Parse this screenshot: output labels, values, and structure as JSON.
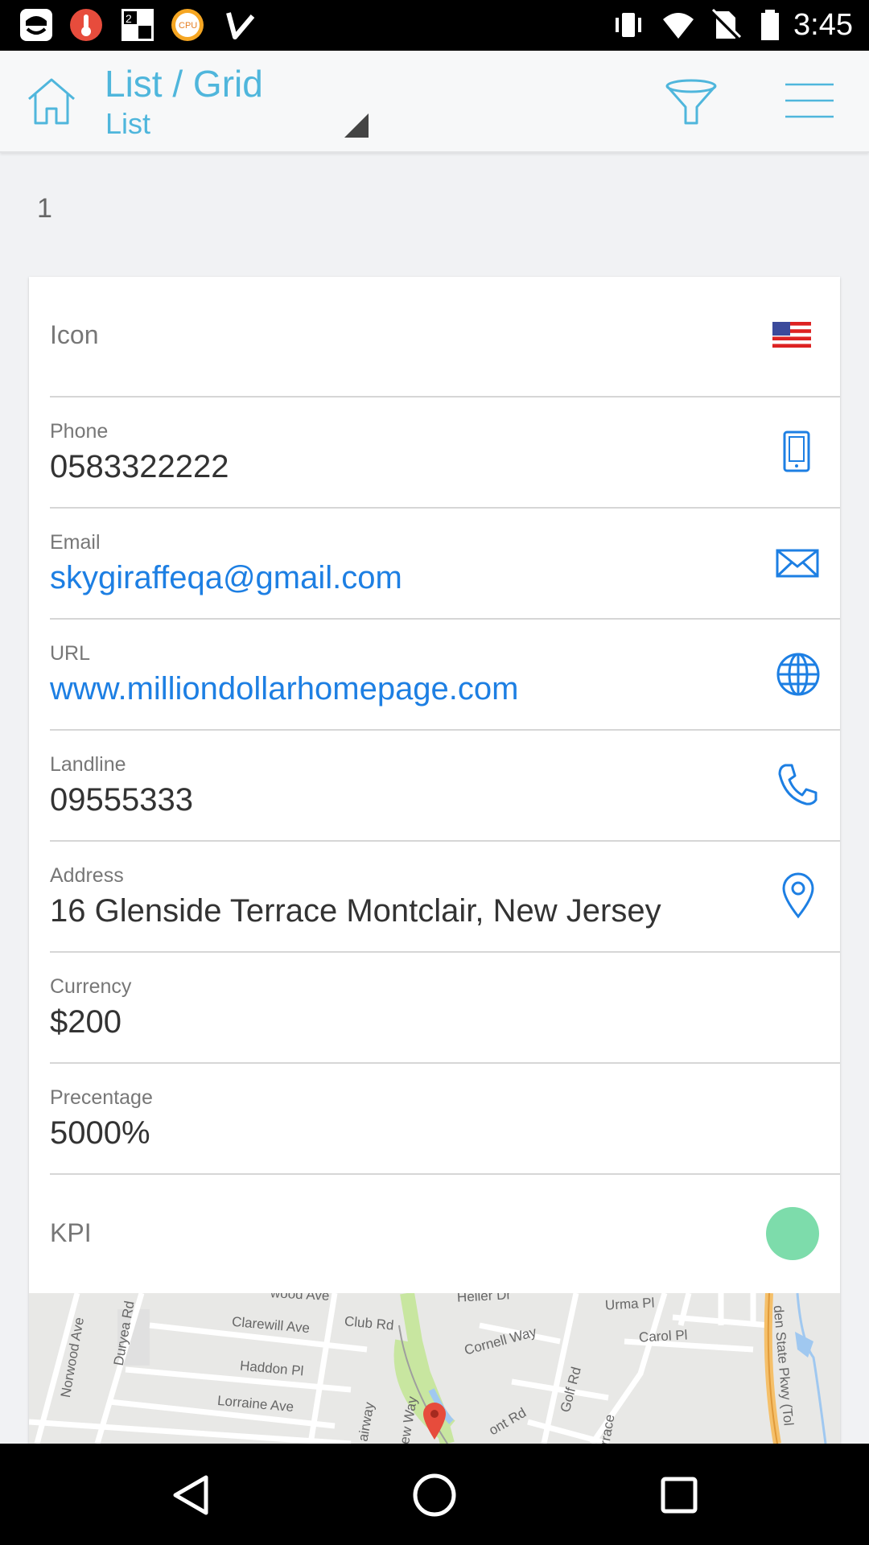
{
  "status_bar": {
    "time": "3:45",
    "notification_icons": [
      "coin-head-icon",
      "thermometer-icon",
      "two-squares-icon",
      "cpu-icon",
      "check-icon"
    ],
    "system_icons": [
      "vibrate-icon",
      "wifi-icon",
      "no-sim-icon",
      "battery-icon"
    ]
  },
  "app_bar": {
    "title": "List / Grid",
    "subtitle": "List",
    "accent": "#4fb6dc"
  },
  "section_number": "1",
  "card": {
    "icon_row": {
      "label": "Icon",
      "flag": "us-flag-icon"
    },
    "phone": {
      "label": "Phone",
      "value": "0583322222"
    },
    "email": {
      "label": "Email",
      "value": "skygiraffeqa@gmail.com"
    },
    "url": {
      "label": "URL",
      "value": "www.milliondollarhomepage.com"
    },
    "landline": {
      "label": "Landline",
      "value": "09555333"
    },
    "address": {
      "label": "Address",
      "value": "16 Glenside Terrace Montclair, New Jersey"
    },
    "currency": {
      "label": "Currency",
      "value": "$200"
    },
    "percentage": {
      "label": "Precentage",
      "value": "5000%"
    },
    "kpi": {
      "label": "KPI",
      "color": "#7ddcab"
    }
  },
  "map": {
    "streets": [
      "Norwood Ave",
      "Duryea Rd",
      "Clarewill Ave",
      "Club Rd",
      "Haddon Pl",
      "Lorraine Ave",
      "Cornell Way",
      "Golf Rd",
      "Urma Pl",
      "Carol Pl",
      "Heller Dr",
      "den State Pkwy (Tol",
      "wood Ave",
      "airway",
      "iew Way",
      "ont Rd",
      "rrace"
    ]
  },
  "link_color": "#1d7fe3"
}
